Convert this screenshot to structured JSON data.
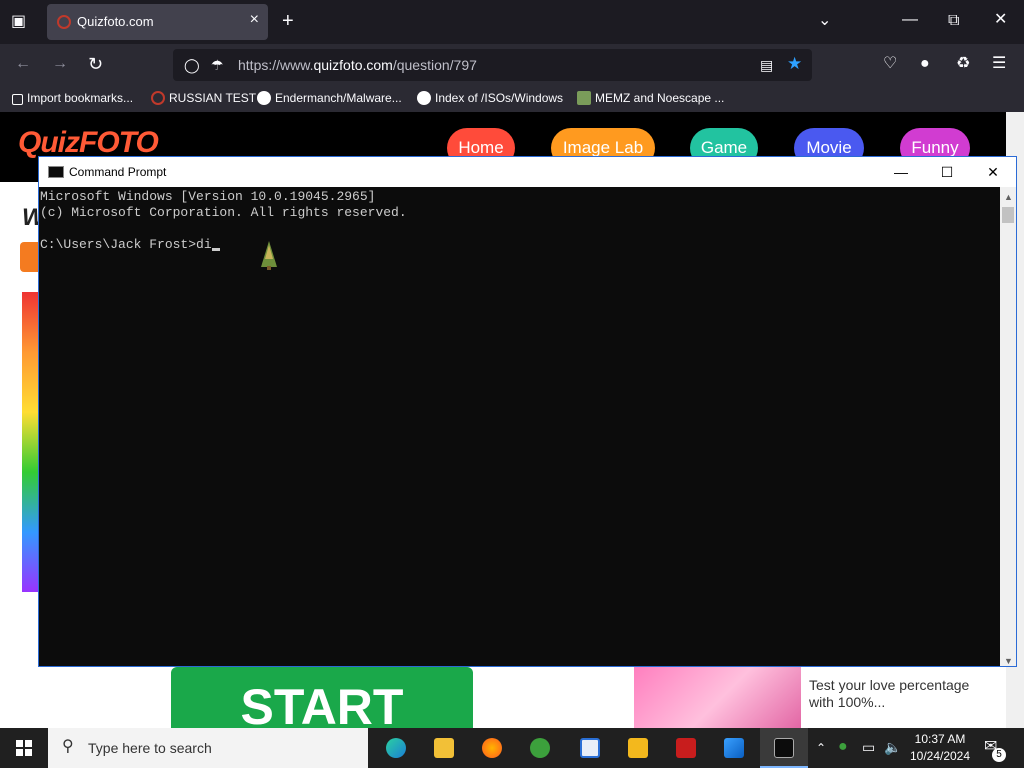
{
  "browser": {
    "tab_title": "Quizfoto.com",
    "url_prefix": "https://www.",
    "url_domain": "quizfoto.com",
    "url_path": "/question/797",
    "bookmarks": [
      {
        "label": "Import bookmarks..."
      },
      {
        "label": "RUSSIAN TEST"
      },
      {
        "label": "Endermanch/Malware..."
      },
      {
        "label": "Index of /ISOs/Windows"
      },
      {
        "label": "MEMZ and Noescape ..."
      }
    ]
  },
  "site": {
    "logo": "QuizFOTO",
    "nav": [
      "Home",
      "Image Lab",
      "Game",
      "Movie",
      "Funny"
    ],
    "nav_colors": [
      "#ff4b3a",
      "#ff9a1f",
      "#22c3a0",
      "#4a59f0",
      "#d13cd1"
    ],
    "side_heading_fragment": "W",
    "start_label": "START",
    "love_text": "Test your love percentage with 100%..."
  },
  "cmd": {
    "title": "Command Prompt",
    "lines": [
      "Microsoft Windows [Version 10.0.19045.2965]",
      "(c) Microsoft Corporation. All rights reserved.",
      "",
      "C:\\Users\\Jack Frost>di"
    ]
  },
  "taskbar": {
    "search_placeholder": "Type here to search",
    "time": "10:37 AM",
    "date": "10/24/2024",
    "notification_count": "5"
  }
}
